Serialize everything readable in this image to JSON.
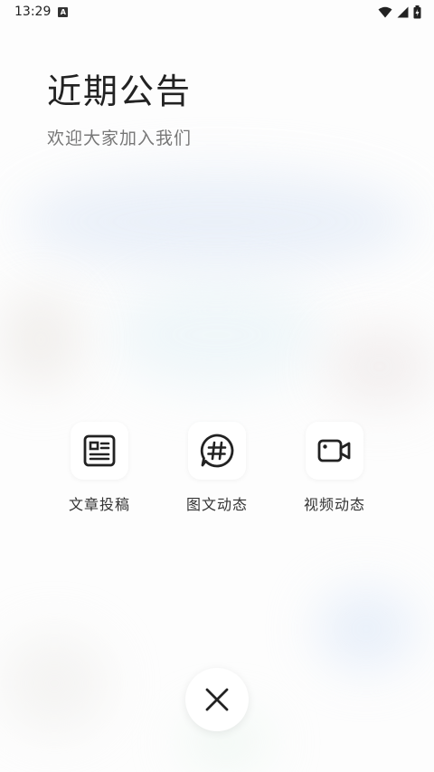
{
  "status_bar": {
    "time": "13:29",
    "badge": "A",
    "icons": [
      "wifi-icon",
      "signal-icon",
      "battery-icon"
    ]
  },
  "header": {
    "title": "近期公告",
    "subtitle": "欢迎大家加入我们"
  },
  "actions": [
    {
      "label": "文章投稿",
      "icon": "article-icon"
    },
    {
      "label": "图文动态",
      "icon": "hashtag-chat-icon"
    },
    {
      "label": "视频动态",
      "icon": "video-camera-icon"
    }
  ],
  "close": {
    "icon": "close-icon"
  },
  "colors": {
    "icon_stroke": "#222222",
    "label_text": "#333333",
    "subtitle_text": "#777777"
  }
}
